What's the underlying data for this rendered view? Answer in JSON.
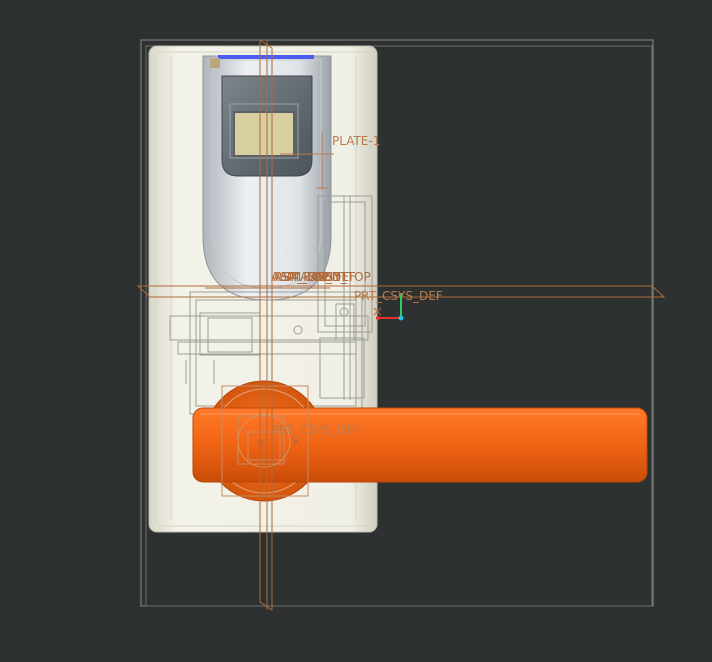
{
  "viewport": {
    "background": "#2e3131",
    "datum_color": "#b06a3a",
    "annotation_color": "#b87b4e"
  },
  "model": {
    "plate_label": "PLATE-1",
    "overlapping_datum_labels": [
      "ASM_RIGHT",
      "ASM_TOP",
      "ASM_FRONT",
      "ASM_DEF",
      "ASSY_TOP"
    ],
    "csys_label_upper": "PRT_CSYS_DEF",
    "csys_label_lower": "PRT_CSYS_DEF",
    "handle_color": "#f06414",
    "escutcheon_color": "#ecebdf",
    "scanner_accent_color": "#4b5cf0"
  },
  "triad": {
    "x_axis_color": "#e53030",
    "y_axis_color": "#30d060",
    "origin_color": "#20c0e0"
  }
}
